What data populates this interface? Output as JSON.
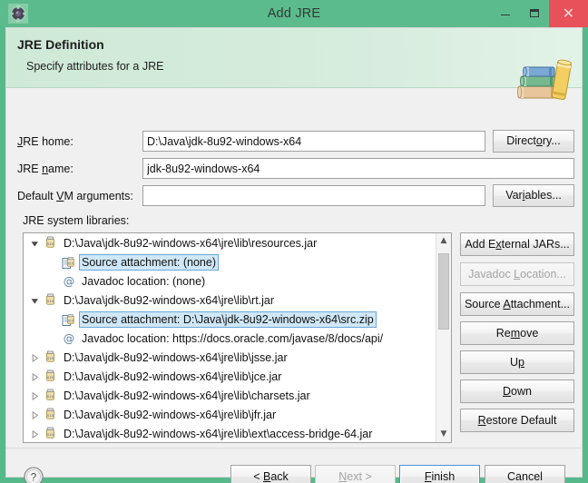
{
  "window": {
    "title": "Add JRE",
    "icon": "gear-icon",
    "controls": {
      "minimize": "minimize-icon",
      "maximize": "maximize-icon",
      "close": "✕"
    },
    "colors": {
      "titlebar": "#5cbb8d",
      "banner_start": "#cfe9d7",
      "banner_end": "#e2f2e7",
      "close_button": "#e8505a",
      "selection": "#cfe7f7",
      "selection_border": "#6aa8d8",
      "default_button_border": "#4a90d9"
    }
  },
  "banner": {
    "title": "JRE Definition",
    "subtitle": "Specify attributes for a JRE",
    "icon": "books-icon"
  },
  "form": {
    "jre_home": {
      "label_prefix": "",
      "label_mnemonic": "J",
      "label_suffix": "RE home:",
      "value": "D:\\Java\\jdk-8u92-windows-x64",
      "placeholder": "",
      "button": {
        "prefix": "Direct",
        "mnemonic": "o",
        "suffix": "ry..."
      }
    },
    "jre_name": {
      "label_prefix": "JRE ",
      "label_mnemonic": "n",
      "label_suffix": "ame:",
      "value": "jdk-8u92-windows-x64",
      "placeholder": ""
    },
    "vm_args": {
      "label_prefix": "Default ",
      "label_mnemonic": "V",
      "label_suffix": "M arguments:",
      "value": "",
      "placeholder": "",
      "button": {
        "prefix": "Var",
        "mnemonic": "i",
        "suffix": "ables..."
      }
    },
    "tree_label": "JRE system libraries:"
  },
  "tree": {
    "rows": [
      {
        "label": "D:\\Java\\jdk-8u92-windows-x64\\jre\\lib\\resources.jar",
        "icon": "jar-icon",
        "indent": 0,
        "arrow": "expanded",
        "selected": false
      },
      {
        "label": "Source attachment: (none)",
        "icon": "source-attachment-icon",
        "indent": 1,
        "arrow": "none",
        "selected": true
      },
      {
        "label": "Javadoc location: (none)",
        "icon": "javadoc-icon",
        "indent": 1,
        "arrow": "none",
        "selected": false
      },
      {
        "label": "D:\\Java\\jdk-8u92-windows-x64\\jre\\lib\\rt.jar",
        "icon": "jar-icon",
        "indent": 0,
        "arrow": "expanded",
        "selected": false
      },
      {
        "label": "Source attachment: D:\\Java\\jdk-8u92-windows-x64\\src.zip",
        "icon": "source-attachment-icon",
        "indent": 1,
        "arrow": "none",
        "selected": true
      },
      {
        "label": "Javadoc location: https://docs.oracle.com/javase/8/docs/api/",
        "icon": "javadoc-icon",
        "indent": 1,
        "arrow": "none",
        "selected": false
      },
      {
        "label": "D:\\Java\\jdk-8u92-windows-x64\\jre\\lib\\jsse.jar",
        "icon": "jar-icon",
        "indent": 0,
        "arrow": "collapsed",
        "selected": false
      },
      {
        "label": "D:\\Java\\jdk-8u92-windows-x64\\jre\\lib\\jce.jar",
        "icon": "jar-icon",
        "indent": 0,
        "arrow": "collapsed",
        "selected": false
      },
      {
        "label": "D:\\Java\\jdk-8u92-windows-x64\\jre\\lib\\charsets.jar",
        "icon": "jar-icon",
        "indent": 0,
        "arrow": "collapsed",
        "selected": false
      },
      {
        "label": "D:\\Java\\jdk-8u92-windows-x64\\jre\\lib\\jfr.jar",
        "icon": "jar-icon",
        "indent": 0,
        "arrow": "collapsed",
        "selected": false
      },
      {
        "label": "D:\\Java\\jdk-8u92-windows-x64\\jre\\lib\\ext\\access-bridge-64.jar",
        "icon": "jar-icon",
        "indent": 0,
        "arrow": "collapsed",
        "selected": false
      }
    ],
    "scrollbar": {
      "up": "▲",
      "down": "▼"
    }
  },
  "side_buttons": [
    {
      "prefix": "Add E",
      "mnemonic": "x",
      "suffix": "ternal JARs...",
      "disabled": false
    },
    {
      "prefix": "Javadoc ",
      "mnemonic": "L",
      "suffix": "ocation...",
      "disabled": true
    },
    {
      "prefix": "Source ",
      "mnemonic": "A",
      "suffix": "ttachment...",
      "disabled": false
    },
    {
      "prefix": "Re",
      "mnemonic": "m",
      "suffix": "ove",
      "disabled": false
    },
    {
      "prefix": "U",
      "mnemonic": "p",
      "suffix": "",
      "disabled": false
    },
    {
      "prefix": "",
      "mnemonic": "D",
      "suffix": "own",
      "disabled": false
    },
    {
      "prefix": "",
      "mnemonic": "R",
      "suffix": "estore Default",
      "disabled": false
    }
  ],
  "footer": {
    "help": "?",
    "buttons": [
      {
        "prefix": "< ",
        "mnemonic": "B",
        "suffix": "ack",
        "disabled": false,
        "default": false
      },
      {
        "prefix": "",
        "mnemonic": "N",
        "suffix": "ext >",
        "disabled": true,
        "default": false
      },
      {
        "prefix": "",
        "mnemonic": "F",
        "suffix": "inish",
        "disabled": false,
        "default": true
      },
      {
        "prefix": "Cancel",
        "mnemonic": "",
        "suffix": "",
        "disabled": false,
        "default": false
      }
    ]
  }
}
